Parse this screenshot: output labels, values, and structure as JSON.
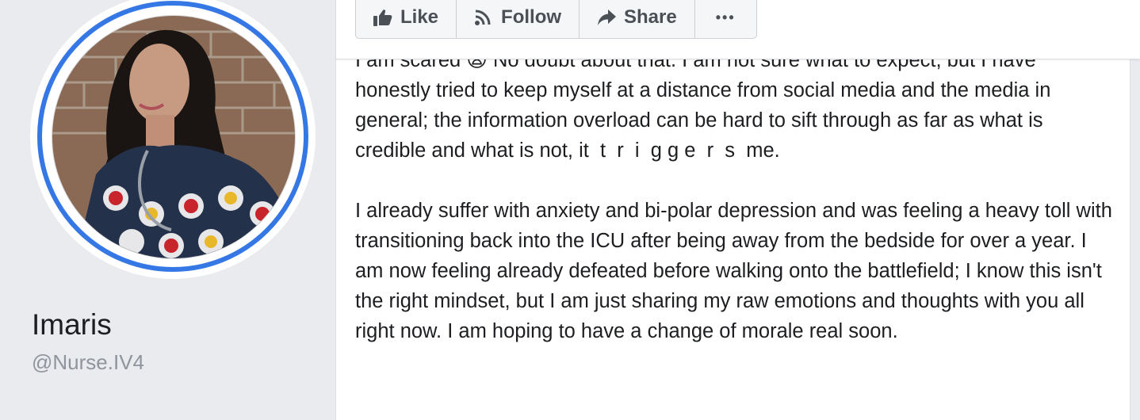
{
  "profile": {
    "name": "Imaris",
    "handle": "@Nurse.IV4"
  },
  "actions": {
    "like_label": "Like",
    "follow_label": "Follow",
    "share_label": "Share",
    "more_label": "•••"
  },
  "post": {
    "paragraphs": [
      "I am scared 😨 No doubt about that. I am not sure what to expect, but I have honestly tried to keep myself at a distance from social media and the media in general; the information overload can be hard to sift through as far as what is credible and what is not, it  t  r  i  g g e  r  s  me.",
      "I already suffer with anxiety and bi-polar depression and was feeling a heavy toll with transitioning back into the ICU after being away from the bedside for over a year. I am now feeling already defeated before walking onto the battlefield; I know this isn't the right mindset, but I am just sharing my raw emotions and thoughts with you all right now. I am hoping to have a change of morale real soon."
    ]
  },
  "colors": {
    "ring": "#3578e5",
    "background": "#e9ebee",
    "button_text": "#4b4f56"
  }
}
